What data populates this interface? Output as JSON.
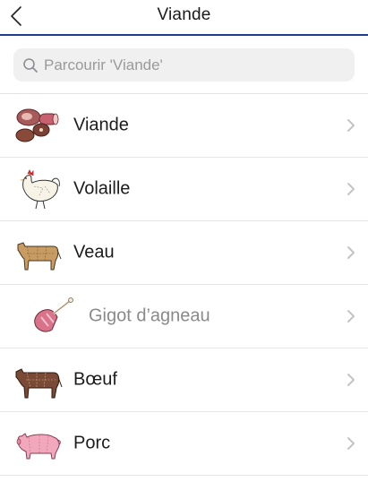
{
  "nav": {
    "title": "Viande",
    "back_icon": "chevron-left-icon"
  },
  "search": {
    "placeholder": "Parcourir 'Viande'",
    "value": "",
    "icon": "search-icon"
  },
  "categories": [
    {
      "label": "Viande",
      "icon": "meat-cuts-icon"
    },
    {
      "label": "Volaille",
      "icon": "chicken-icon"
    },
    {
      "label": "Veau",
      "icon": "calf-icon"
    },
    {
      "label": "Gigot d’agneau",
      "icon": "lamb-leg-icon",
      "sub": true
    },
    {
      "label": "Bœuf",
      "icon": "cow-icon"
    },
    {
      "label": "Porc",
      "icon": "pig-icon"
    }
  ],
  "colors": {
    "accent": "#1f3a8f",
    "chevron": "#c4c4c8",
    "search_bg": "#f0f0f0"
  }
}
